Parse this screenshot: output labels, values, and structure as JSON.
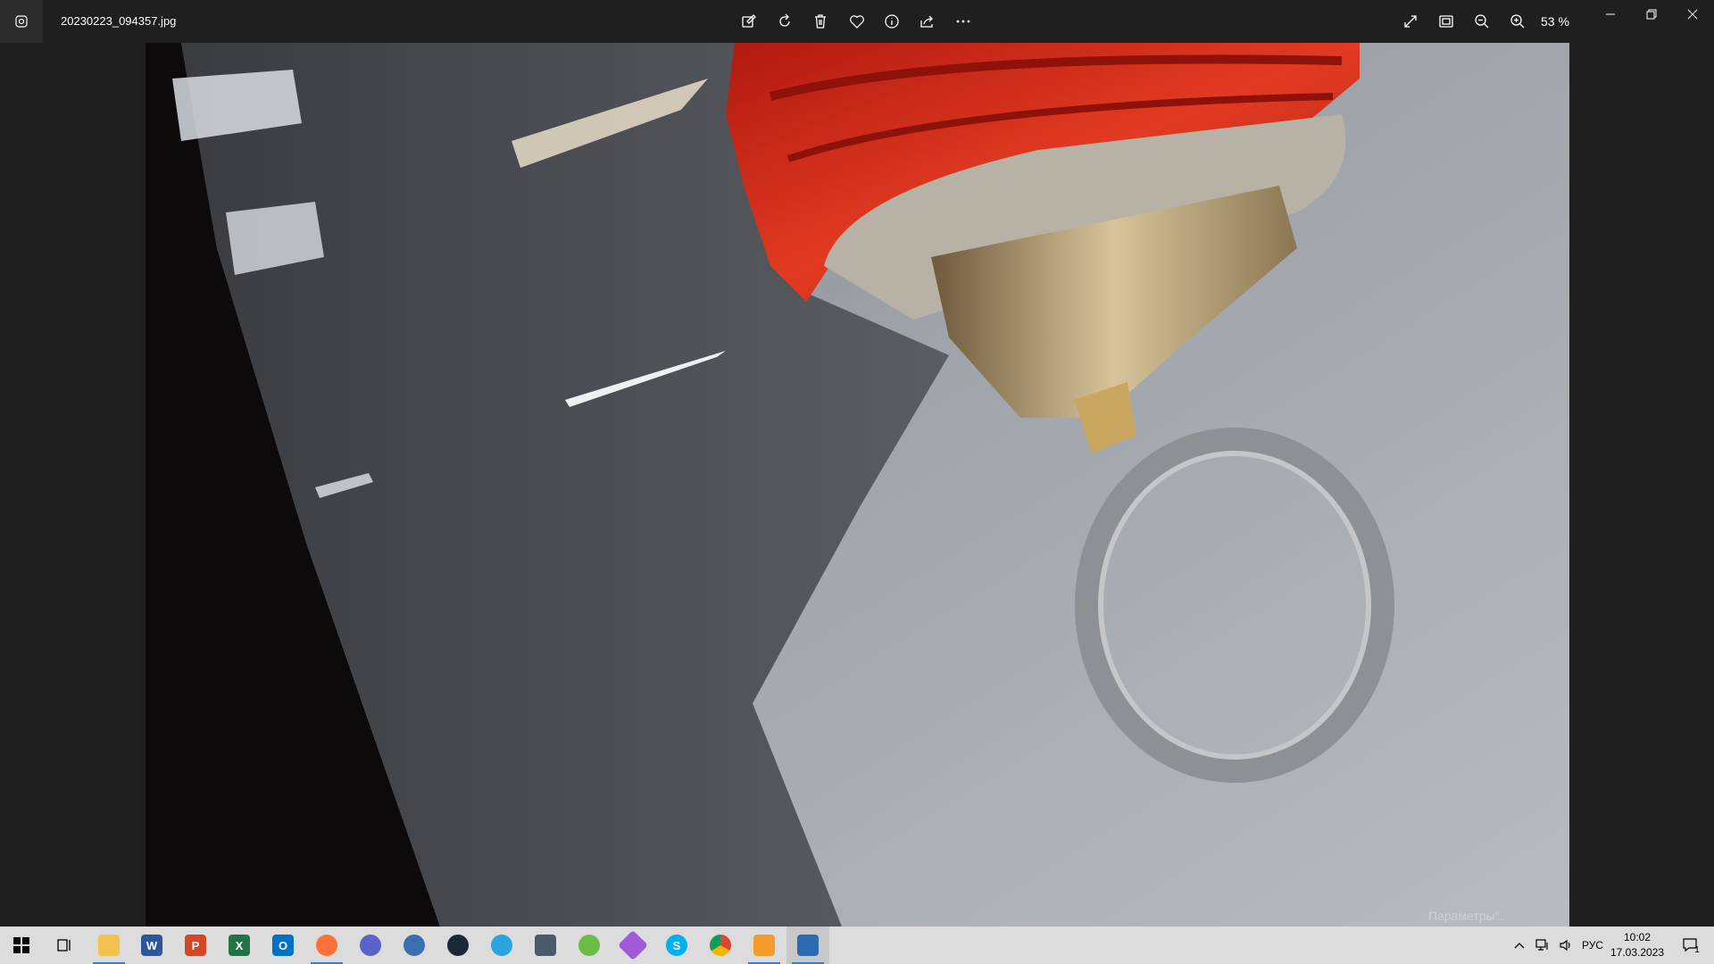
{
  "window": {
    "filename": "20230223_094357.jpg",
    "zoom": "53 %"
  },
  "toolbar": {
    "items": [
      {
        "name": "edit-image-icon"
      },
      {
        "name": "rotate-icon"
      },
      {
        "name": "delete-icon"
      },
      {
        "name": "favorite-icon"
      },
      {
        "name": "info-icon"
      },
      {
        "name": "share-icon"
      },
      {
        "name": "more-icon"
      }
    ]
  },
  "photo": {
    "watermark": "Параметры\"."
  },
  "taskbar": {
    "apps": [
      {
        "name": "start-button",
        "label": "",
        "color": "#000000"
      },
      {
        "name": "task-view-button",
        "label": "",
        "color": "#000000"
      },
      {
        "name": "file-explorer-icon",
        "label": "",
        "color": "#f2c14e"
      },
      {
        "name": "word-icon",
        "label": "W",
        "color": "#2b579a"
      },
      {
        "name": "powerpoint-icon",
        "label": "P",
        "color": "#d24726"
      },
      {
        "name": "excel-icon",
        "label": "X",
        "color": "#217346"
      },
      {
        "name": "outlook-icon",
        "label": "O",
        "color": "#0072c6"
      },
      {
        "name": "firefox-icon",
        "label": "",
        "color": "#ff7139"
      },
      {
        "name": "viber-icon",
        "label": "",
        "color": "#5b62c8"
      },
      {
        "name": "github-icon",
        "label": "",
        "color": "#3a6fb0"
      },
      {
        "name": "steam-icon",
        "label": "",
        "color": "#1b2838"
      },
      {
        "name": "telegram-icon",
        "label": "",
        "color": "#2aa3df"
      },
      {
        "name": "calculator-icon",
        "label": "",
        "color": "#4a5a6a"
      },
      {
        "name": "utorrent-icon",
        "label": "",
        "color": "#6bbd45"
      },
      {
        "name": "paint3d-icon",
        "label": "",
        "color": "#a05ad8"
      },
      {
        "name": "skype-icon",
        "label": "S",
        "color": "#00aff0"
      },
      {
        "name": "chrome-icon",
        "label": "",
        "color": "#db4437"
      },
      {
        "name": "media-player-icon",
        "label": "",
        "color": "#f59b2b"
      },
      {
        "name": "photos-app-icon",
        "label": "",
        "color": "#2b6cb0"
      }
    ],
    "language": "РУС",
    "time": "10:02",
    "date": "17.03.2023",
    "notifications": "1"
  }
}
